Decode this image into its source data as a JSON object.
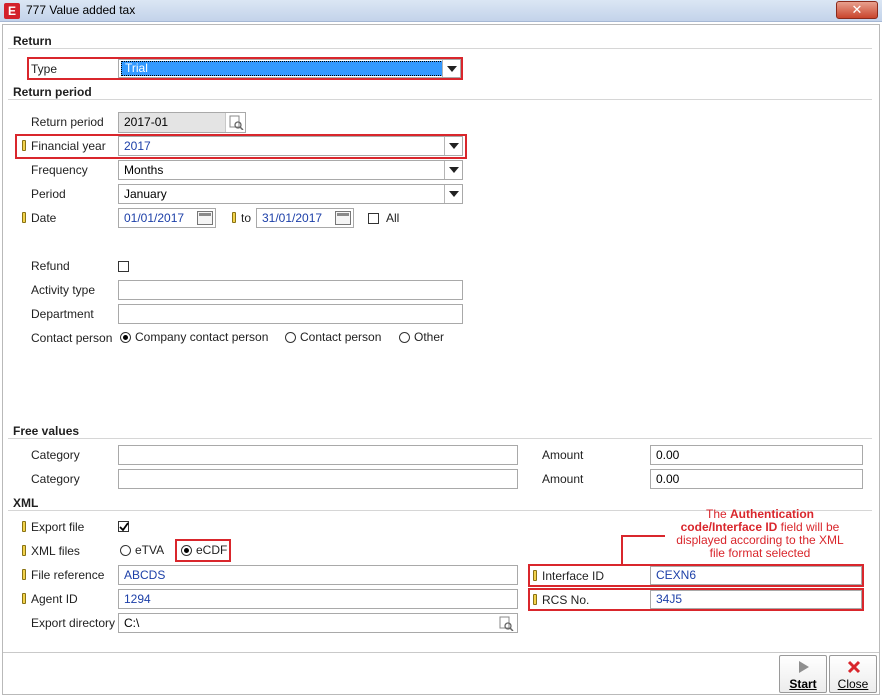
{
  "window": {
    "title": "777 Value added tax",
    "app_icon": "E",
    "close_symbol": "✕"
  },
  "sections": {
    "return": "Return",
    "return_period": "Return period",
    "free_values": "Free values",
    "xml": "XML"
  },
  "fields": {
    "type": {
      "label": "Type",
      "value": "Trial"
    },
    "return_period": {
      "label": "Return period",
      "value": "2017-01"
    },
    "financial_year": {
      "label": "Financial year",
      "value": "2017"
    },
    "frequency": {
      "label": "Frequency",
      "value": "Months"
    },
    "period": {
      "label": "Period",
      "value": "January"
    },
    "date": {
      "label": "Date",
      "from": "01/01/2017",
      "to_label": "to",
      "to": "31/01/2017",
      "all_label": "All"
    },
    "refund": {
      "label": "Refund"
    },
    "activity_type": {
      "label": "Activity type",
      "value": ""
    },
    "department": {
      "label": "Department",
      "value": ""
    },
    "contact_person": {
      "label": "Contact person",
      "options": [
        "Company contact person",
        "Contact person",
        "Other"
      ],
      "selected": 0
    }
  },
  "free_values": {
    "rows": [
      {
        "category_label": "Category",
        "category_value": "",
        "amount_label": "Amount",
        "amount_value": "0.00"
      },
      {
        "category_label": "Category",
        "category_value": "",
        "amount_label": "Amount",
        "amount_value": "0.00"
      }
    ]
  },
  "xml": {
    "export_file": {
      "label": "Export file",
      "checked": true
    },
    "xml_files": {
      "label": "XML files",
      "options": [
        "eTVA",
        "eCDF"
      ],
      "selected": 1
    },
    "file_reference": {
      "label": "File reference",
      "value": "ABCDS"
    },
    "agent_id": {
      "label": "Agent ID",
      "value": "1294"
    },
    "export_directory": {
      "label": "Export directory",
      "value": "C:\\"
    },
    "interface_id": {
      "label": "Interface ID",
      "value": "CEXN6"
    },
    "rcs_no": {
      "label": "RCS No.",
      "value": "34J5"
    }
  },
  "annotation": {
    "line1_prefix": "The ",
    "line1_bold": "Authentication",
    "line2_bold": "code/Interface ID",
    "line2_rest": " field will be",
    "line3": "displayed according to the XML",
    "line4": "file format selected"
  },
  "buttons": {
    "start": {
      "label": "Start",
      "icon": "play-icon"
    },
    "close": {
      "label": "Close",
      "icon": "close-icon"
    }
  },
  "colors": {
    "accent_red": "#d9262c",
    "value_blue": "#1c3fa8",
    "selection_blue": "#3399ff"
  }
}
